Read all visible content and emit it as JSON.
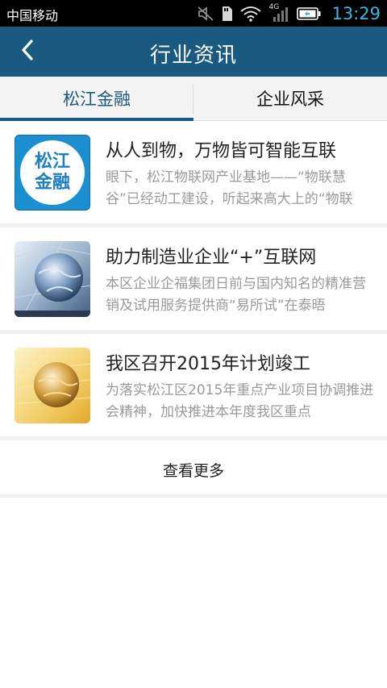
{
  "status_bar": {
    "carrier": "中国移动",
    "network_type": "4G",
    "time": "13:29",
    "icons": [
      "mute-icon",
      "sd-card-icon",
      "wifi-icon",
      "signal-icon",
      "battery-icon"
    ]
  },
  "header": {
    "title": "行业资讯",
    "back_icon": "chevron-left-icon",
    "background_color": "#1a5a80"
  },
  "tabs": [
    {
      "label": "松江金融",
      "active": true
    },
    {
      "label": "企业风采",
      "active": false
    }
  ],
  "news": [
    {
      "title": "从人到物，万物皆可智能互联",
      "summary": "眼下，松江物联网产业基地——“物联慧谷”已经动工建设，听起来高大上的“物联",
      "thumb": {
        "type": "logo",
        "logo_line1": "松江",
        "logo_line2": "金融"
      }
    },
    {
      "title": "助力制造业企业“+”互联网",
      "summary": "本区企业企福集团日前与国内知名的精准营销及试用服务提供商“易所试”在泰晤",
      "thumb": {
        "type": "blue-globe-photo"
      }
    },
    {
      "title": "我区召开2015年计划竣工",
      "summary": "为落实松江区2015年重点产业项目协调推进会精神，加快推进本年度我区重点",
      "thumb": {
        "type": "gold-globe-photo"
      }
    }
  ],
  "load_more": "查看更多",
  "colors": {
    "accent": "#1a5a80",
    "clock": "#35b8e8",
    "summary_text": "#9a9a9a"
  }
}
